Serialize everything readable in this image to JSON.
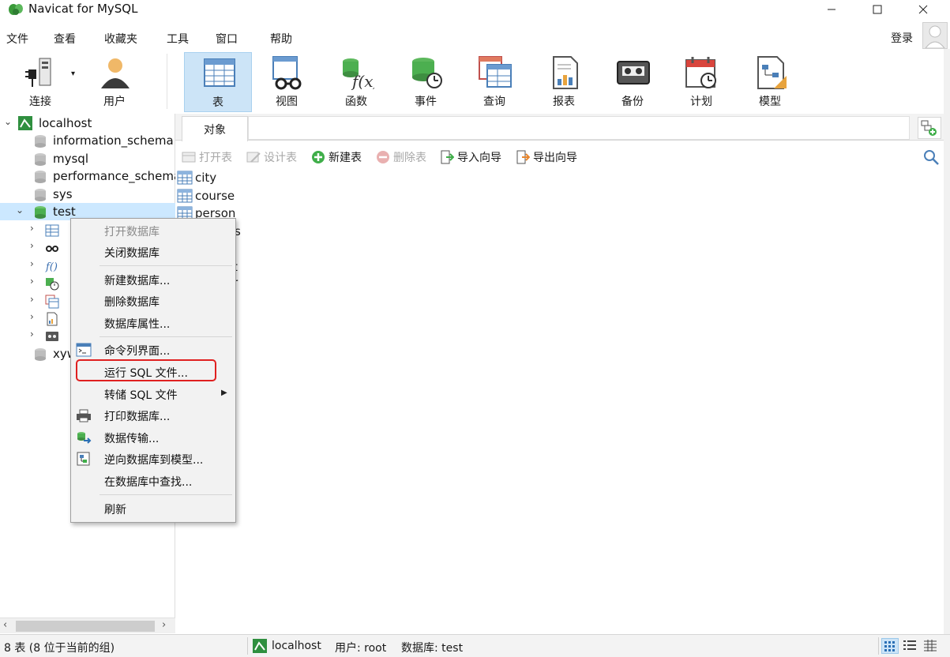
{
  "window": {
    "title": "Navicat for MySQL"
  },
  "menubar": {
    "items": [
      "文件",
      "查看",
      "收藏夹",
      "工具",
      "窗口",
      "帮助"
    ],
    "login_label": "登录"
  },
  "toolbar": {
    "buttons": [
      {
        "label": "连接",
        "icon": "plug-icon"
      },
      {
        "label": "用户",
        "icon": "user-icon"
      },
      {
        "label": "表",
        "icon": "table-icon",
        "active": true
      },
      {
        "label": "视图",
        "icon": "view-glasses-icon"
      },
      {
        "label": "函数",
        "icon": "function-icon"
      },
      {
        "label": "事件",
        "icon": "event-clock-icon"
      },
      {
        "label": "查询",
        "icon": "query-icon"
      },
      {
        "label": "报表",
        "icon": "report-icon"
      },
      {
        "label": "备份",
        "icon": "backup-tape-icon"
      },
      {
        "label": "计划",
        "icon": "schedule-calendar-icon"
      },
      {
        "label": "模型",
        "icon": "model-icon"
      }
    ]
  },
  "tree": {
    "connection": "localhost",
    "databases": [
      "information_schema",
      "mysql",
      "performance_schema",
      "sys",
      "test"
    ],
    "partial_db": "xyw"
  },
  "object_tab": {
    "label": "对象"
  },
  "actions": {
    "open_table": "打开表",
    "design_table": "设计表",
    "new_table": "新建表",
    "delete_table": "删除表",
    "import_wizard": "导入向导",
    "export_wizard": "导出向导"
  },
  "objects": [
    "city",
    "course",
    "person"
  ],
  "partial_objects": [
    "s",
    "t",
    "r"
  ],
  "context_menu": {
    "items": {
      "open_db": "打开数据库",
      "close_db": "关闭数据库",
      "new_db": "新建数据库...",
      "delete_db": "删除数据库",
      "db_props": "数据库属性...",
      "console": "命令列界面...",
      "run_sql": "运行 SQL 文件...",
      "dump_sql": "转储 SQL 文件",
      "print_db": "打印数据库...",
      "data_transfer": "数据传输...",
      "reverse_model": "逆向数据库到模型...",
      "find_in_db": "在数据库中查找...",
      "refresh": "刷新"
    }
  },
  "statusbar": {
    "left": "8 表 (8 位于当前的组)",
    "host": "localhost",
    "user": "用户: root",
    "database": "数据库: test"
  },
  "colors": {
    "toolbar_active": "#cce4f7",
    "tree_selected": "#cce8ff",
    "highlight": "#e02020",
    "navicat_green": "#3a9a3a"
  }
}
